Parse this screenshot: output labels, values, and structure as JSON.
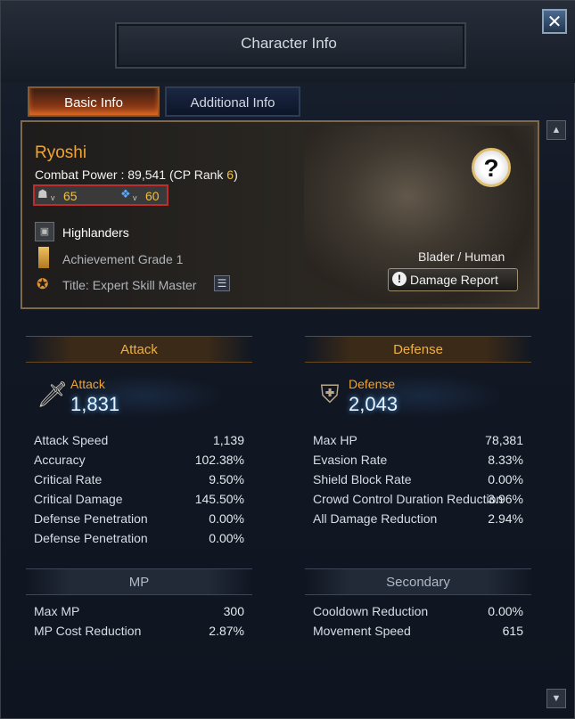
{
  "window": {
    "title": "Character Info",
    "close_label": "✕"
  },
  "tabs": [
    {
      "label": "Basic Info",
      "active": true
    },
    {
      "label": "Additional Info",
      "active": false
    }
  ],
  "character": {
    "name": "Ryoshi",
    "combat_power_prefix": "Combat Power : 89,541 (CP Rank ",
    "cp_rank": "6",
    "combat_power_suffix": ")",
    "level_v_label": "v",
    "level": "65",
    "hm_level": "60",
    "guild": "Highlanders",
    "achievement": "Achievement Grade 1",
    "title": "Title: Expert Skill Master",
    "class_race": "Blader / Human",
    "help_icon": "?",
    "damage_report_label": "Damage Report",
    "damage_report_glyph": "!"
  },
  "attack": {
    "header": "Attack",
    "label": "Attack",
    "value": "1,831",
    "icon_glyph": "🗡",
    "rows": [
      {
        "label": "Attack Speed",
        "value": "1,139"
      },
      {
        "label": "Accuracy",
        "value": "102.38%"
      },
      {
        "label": "Critical Rate",
        "value": "9.50%"
      },
      {
        "label": "Critical Damage",
        "value": "145.50%"
      },
      {
        "label": "Defense Penetration",
        "value": "0.00%"
      },
      {
        "label": "Defense Penetration",
        "value": "0.00%"
      }
    ]
  },
  "defense": {
    "header": "Defense",
    "label": "Defense",
    "value": "2,043",
    "icon_glyph": "⛨",
    "rows": [
      {
        "label": "Max HP",
        "value": "78,381"
      },
      {
        "label": "Evasion Rate",
        "value": "8.33%"
      },
      {
        "label": "Shield Block Rate",
        "value": "0.00%"
      },
      {
        "label": "Crowd Control Duration Reduction",
        "value": "3.96%"
      },
      {
        "label": "All Damage Reduction",
        "value": "2.94%"
      }
    ]
  },
  "mp": {
    "header": "MP",
    "rows": [
      {
        "label": "Max MP",
        "value": "300"
      },
      {
        "label": "MP Cost Reduction",
        "value": "2.87%"
      }
    ]
  },
  "secondary": {
    "header": "Secondary",
    "rows": [
      {
        "label": "Cooldown Reduction",
        "value": "0.00%"
      },
      {
        "label": "Movement Speed",
        "value": "615"
      }
    ]
  },
  "scroll": {
    "up_glyph": "▲",
    "down_glyph": "▼"
  }
}
